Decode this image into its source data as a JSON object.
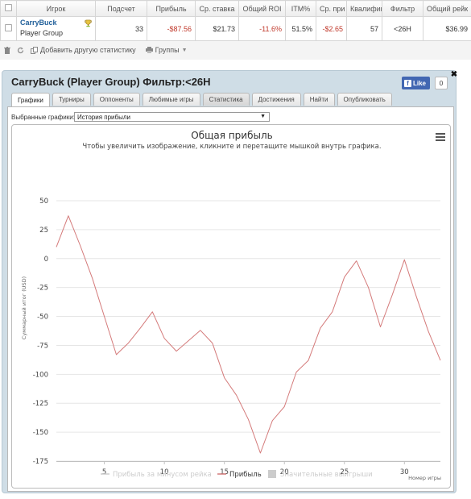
{
  "table": {
    "headers": [
      "",
      "Игрок",
      "Подсчет",
      "Прибыль",
      "Ср. ставка",
      "Общий ROI",
      "ITM%",
      "Ср. при",
      "Квалифик",
      "Фильтр",
      "Общий рейк"
    ],
    "row": {
      "player_name": "CarryBuck",
      "player_group": "Player Group",
      "count": "33",
      "profit": "-$87.56",
      "avg_stake": "$21.73",
      "roi": "-11.6%",
      "itm": "51.5%",
      "avg_profit": "-$2.65",
      "qualif": "57",
      "filter": "<26H",
      "rake": "$36.99"
    }
  },
  "toolbar": {
    "add_stat": "Добавить другую статистику",
    "groups": "Группы"
  },
  "modal": {
    "title": "CarryBuck (Player Group) Фильтр:<26H",
    "like_label": "Like",
    "like_count": "0",
    "tabs": [
      "Графики",
      "Турниры",
      "Оппоненты",
      "Любимые игры",
      "Статистика",
      "Достижения",
      "Найти",
      "Опубликовать"
    ],
    "active_tab": "Графики",
    "select_label": "Выбранные графики:",
    "select_value": "История прибыли"
  },
  "colors": {
    "line": "#d47a7a",
    "neg_text": "#c0392b",
    "modal_bg": "#cfdde6",
    "link": "#1f5e99"
  },
  "chart_data": {
    "type": "line",
    "title": "Общая прибыль",
    "subtitle": "Чтобы увеличить изображение, кликните и перетащите мышкой внутрь графика.",
    "xlabel": "Номер игры",
    "ylabel": "Суммарный итог (USD)",
    "xlim": [
      1,
      33
    ],
    "ylim": [
      -175,
      50
    ],
    "xticks": [
      5,
      10,
      15,
      20,
      25,
      30
    ],
    "yticks": [
      50,
      25,
      0,
      -25,
      -50,
      -75,
      -100,
      -125,
      -150,
      -175
    ],
    "grid": true,
    "legend_position": "bottom",
    "series": [
      {
        "name": "Прибыль за минусом рейка",
        "color": "#cccccc",
        "values": []
      },
      {
        "name": "Прибыль",
        "color": "#d47a7a",
        "x": [
          1,
          2,
          3,
          4,
          5,
          6,
          7,
          8,
          9,
          10,
          11,
          12,
          13,
          14,
          15,
          16,
          17,
          18,
          19,
          20,
          21,
          22,
          23,
          24,
          25,
          26,
          27,
          28,
          29,
          30,
          31,
          32,
          33
        ],
        "values": [
          10,
          37,
          11,
          -17,
          -50,
          -83,
          -73,
          -60,
          -46,
          -69,
          -80,
          -71,
          -62,
          -73,
          -103,
          -118,
          -139,
          -168,
          -140,
          -128,
          -98,
          -88,
          -60,
          -46,
          -16,
          -2,
          -25,
          -59,
          -31,
          -1,
          -33,
          -63,
          -88
        ]
      },
      {
        "name": "Значительные выигрыши",
        "color": "#cccccc",
        "values": []
      }
    ]
  }
}
